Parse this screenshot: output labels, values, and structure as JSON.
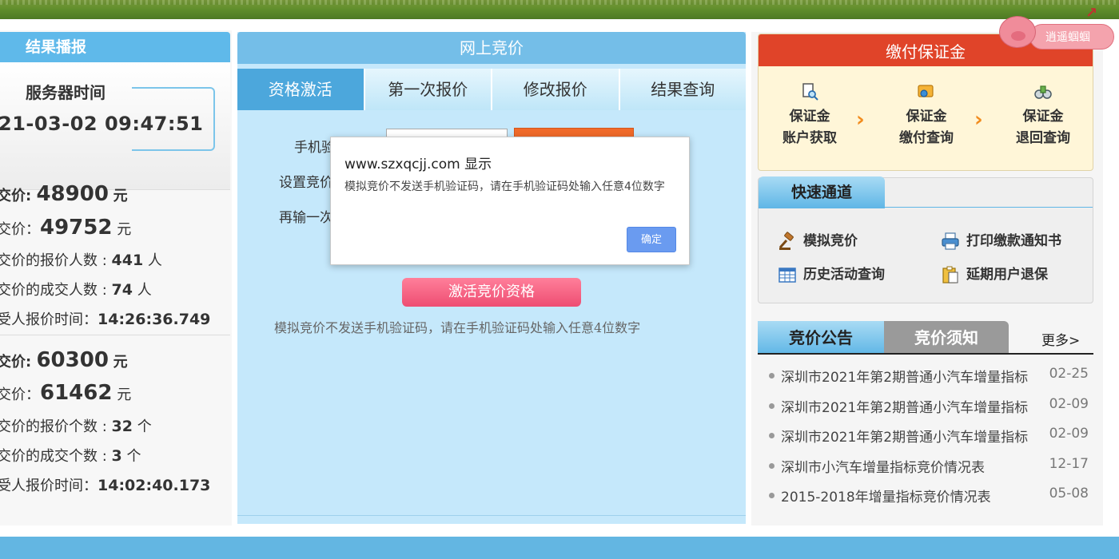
{
  "left": {
    "title": "结果播报",
    "server_time_label": "服务器时间",
    "server_time": "21-03-02 09:47:51",
    "group1": {
      "low_price_label": "交价: ",
      "low_price": "48900",
      "avg_price_label": "交价：",
      "avg_price": "49752",
      "bidders_label": "交价的报价人数 : ",
      "bidders": "441",
      "deals_label": "交价的成交人数 : ",
      "deals": "74",
      "last_time_label": "受人报价时间：",
      "last_time": "14:26:36.749",
      "unit_yuan": "元",
      "unit_person": "人"
    },
    "group2": {
      "low_price_label": "交价: ",
      "low_price": "60300",
      "avg_price_label": "交价：",
      "avg_price": "61462",
      "bidders_label": "交价的报价个数 : ",
      "bidders": "32",
      "deals_label": "交价的成交个数 : ",
      "deals": "3",
      "last_time_label": "受人报价时间：",
      "last_time": "14:02:40.173",
      "unit_yuan": "元",
      "unit_count": "个"
    }
  },
  "middle": {
    "title": "网上竞价",
    "tabs": [
      "资格激活",
      "第一次报价",
      "修改报价",
      "结果查询"
    ],
    "labels": [
      "手机验",
      "设置竞价",
      "再输一次"
    ],
    "activate_button": "激活竞价资格",
    "hint": "模拟竞价不发送手机验证码，请在手机验证码处输入任意4位数字"
  },
  "dialog": {
    "title": "www.szxqcjj.com 显示",
    "message": "模拟竞价不发送手机验证码，请在手机验证码处输入任意4位数字",
    "ok": "确定"
  },
  "right": {
    "deposit_title": "缴付保证金",
    "deposit_items": [
      {
        "line1": "保证金",
        "line2": "账户获取"
      },
      {
        "line1": "保证金",
        "line2": "缴付查询"
      },
      {
        "line1": "保证金",
        "line2": "退回查询"
      }
    ],
    "badge": "逍遥蝈蝈",
    "quick_title": "快速通道",
    "quick_items": [
      "模拟竞价",
      "打印缴款通知书",
      "历史活动查询",
      "延期用户退保"
    ],
    "notice_tab": "竞价公告",
    "rules_tab": "竞价须知",
    "more": "更多>",
    "news": [
      {
        "title": "深圳市2021年第2期普通小汽车增量指标",
        "date": "02-25"
      },
      {
        "title": "深圳市2021年第2期普通小汽车增量指标",
        "date": "02-09"
      },
      {
        "title": "深圳市2021年第2期普通小汽车增量指标",
        "date": "02-09"
      },
      {
        "title": "深圳市小汽车增量指标竞价情况表",
        "date": "12-17"
      },
      {
        "title": "2015-2018年增量指标竞价情况表",
        "date": "05-08"
      }
    ]
  }
}
